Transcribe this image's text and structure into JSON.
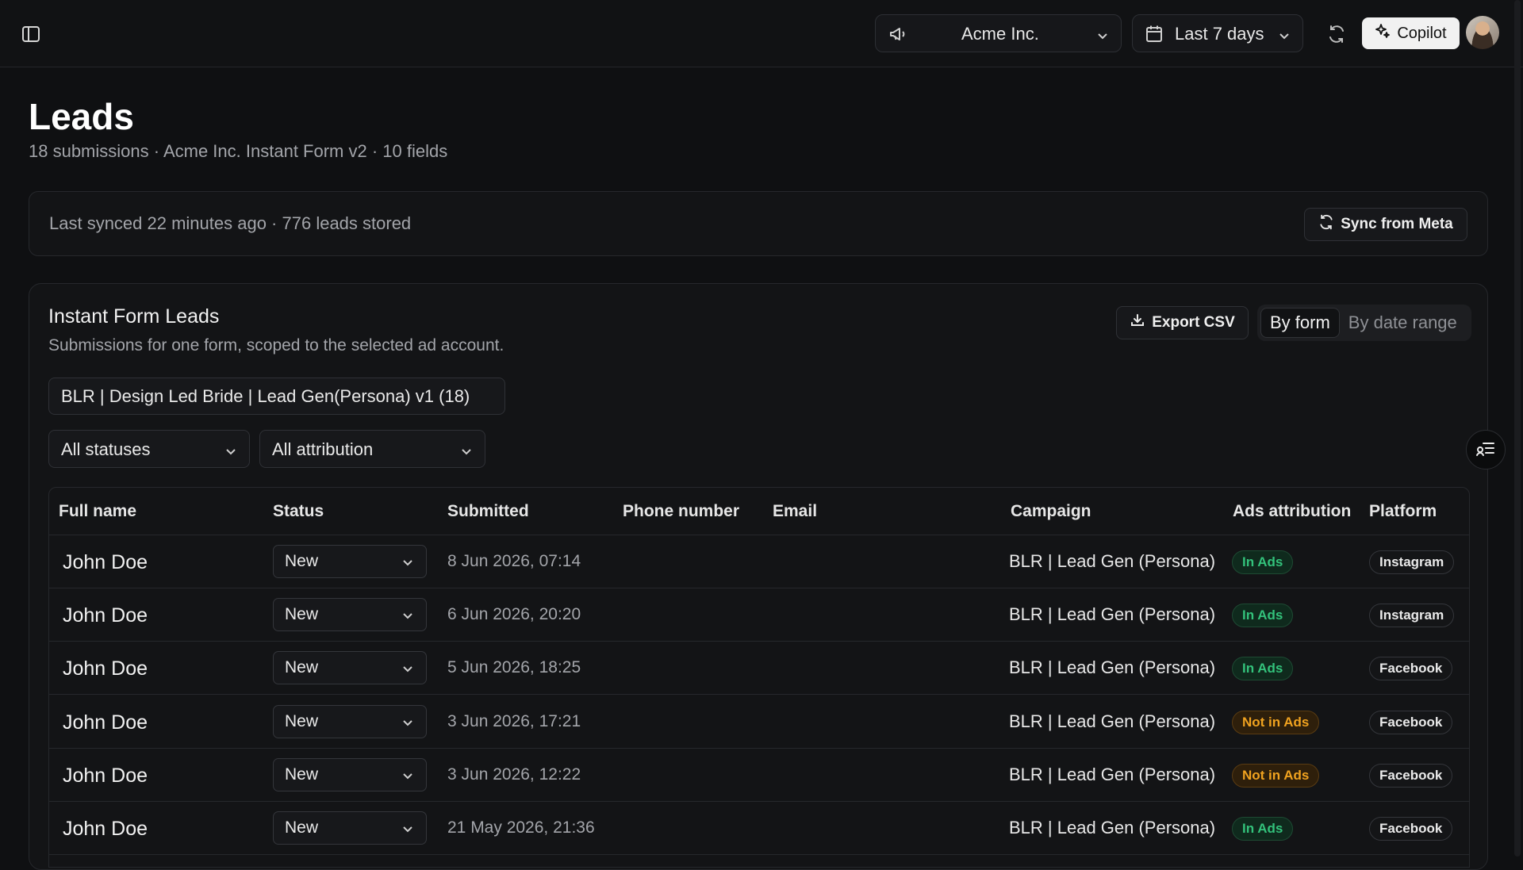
{
  "topbar": {
    "account": "Acme Inc.",
    "date_range": "Last 7 days",
    "copilot_label": "Copilot"
  },
  "page": {
    "title": "Leads",
    "subtitle": "18 submissions · Acme Inc. Instant Form v2 · 10 fields"
  },
  "sync": {
    "text": "Last synced 22 minutes ago · 776 leads stored",
    "button_label": "Sync from Meta"
  },
  "leads_card": {
    "title": "Instant Form Leads",
    "description": "Submissions for one form, scoped to the selected ad account.",
    "export_label": "Export CSV",
    "view_toggle": [
      "By form",
      "By date range"
    ],
    "active_view": "By form",
    "form_select": "BLR | Design Led Bride | Lead Gen(Persona) v1 (18)",
    "status_filter": "All statuses",
    "attribution_filter": "All attribution"
  },
  "table": {
    "columns": [
      "Full name",
      "Status",
      "Submitted",
      "Phone number",
      "Email",
      "Campaign",
      "Ads attribution",
      "Platform"
    ],
    "rows": [
      {
        "name": "John Doe",
        "status": "New",
        "submitted": "8 Jun 2026, 07:14",
        "phone": "",
        "email": "",
        "campaign": "BLR | Lead Gen (Persona)",
        "attribution": "In Ads",
        "platform": "Instagram"
      },
      {
        "name": "John Doe",
        "status": "New",
        "submitted": "6 Jun 2026, 20:20",
        "phone": "",
        "email": "",
        "campaign": "BLR | Lead Gen (Persona)",
        "attribution": "In Ads",
        "platform": "Instagram"
      },
      {
        "name": "John Doe",
        "status": "New",
        "submitted": "5 Jun 2026, 18:25",
        "phone": "",
        "email": "",
        "campaign": "BLR | Lead Gen (Persona)",
        "attribution": "In Ads",
        "platform": "Facebook"
      },
      {
        "name": "John Doe",
        "status": "New",
        "submitted": "3 Jun 2026, 17:21",
        "phone": "",
        "email": "",
        "campaign": "BLR | Lead Gen (Persona)",
        "attribution": "Not in Ads",
        "platform": "Facebook"
      },
      {
        "name": "John Doe",
        "status": "New",
        "submitted": "3 Jun 2026, 12:22",
        "phone": "",
        "email": "",
        "campaign": "BLR | Lead Gen (Persona)",
        "attribution": "Not in Ads",
        "platform": "Facebook"
      },
      {
        "name": "John Doe",
        "status": "New",
        "submitted": "21 May 2026, 21:36",
        "phone": "",
        "email": "",
        "campaign": "BLR | Lead Gen (Persona)",
        "attribution": "In Ads",
        "platform": "Facebook"
      }
    ]
  },
  "colors": {
    "background": "#0f1012",
    "in_ads": "#33c27b",
    "not_in_ads": "#f0a21f"
  },
  "icons": [
    "sidebar-toggle-icon",
    "megaphone-icon",
    "calendar-icon",
    "chevron-down-icon",
    "refresh-icon",
    "sparkle-icon",
    "download-icon",
    "filter-list-icon"
  ]
}
